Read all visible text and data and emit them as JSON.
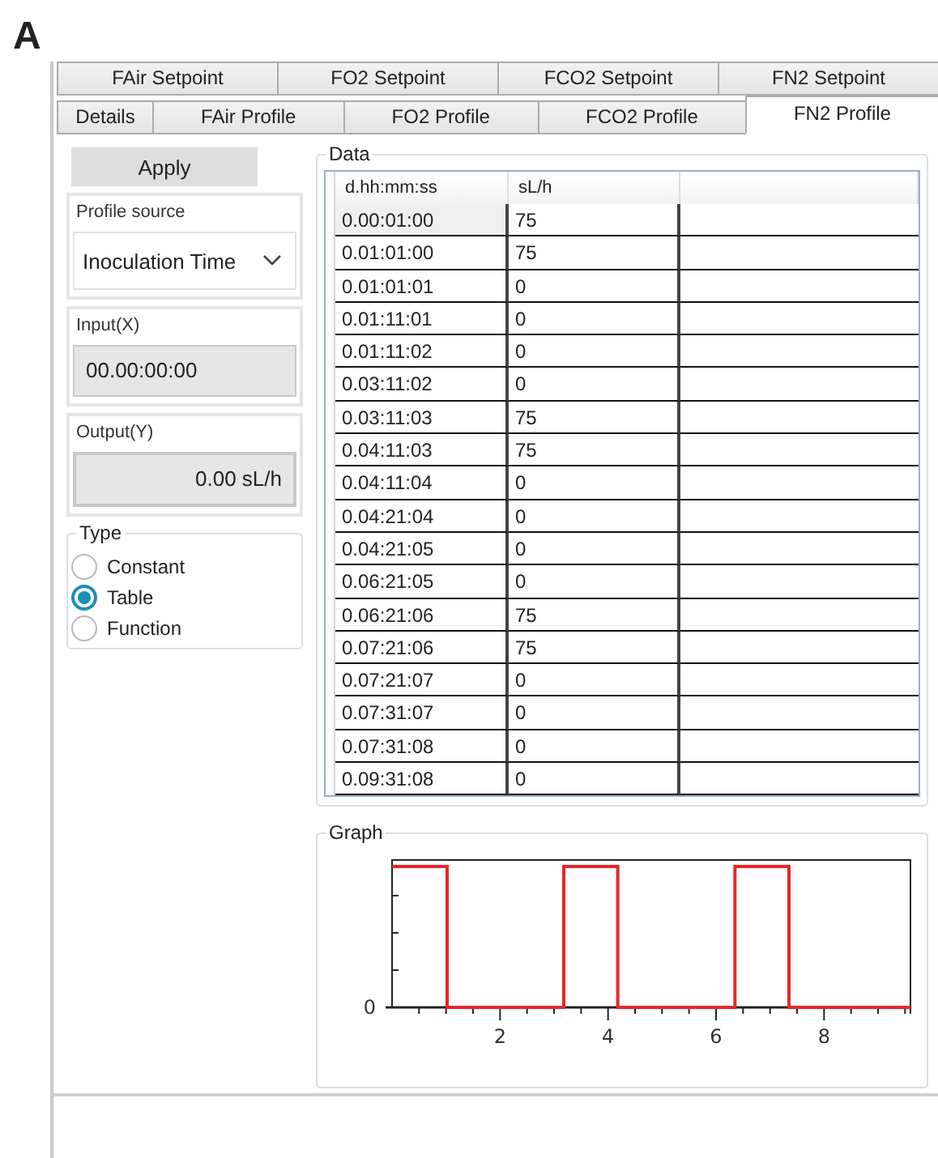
{
  "figure_label": "A",
  "tabs_top": [
    {
      "label": "FAir Setpoint",
      "selected": false
    },
    {
      "label": "FO2 Setpoint",
      "selected": false
    },
    {
      "label": "FCO2 Setpoint",
      "selected": false
    },
    {
      "label": "FN2 Setpoint",
      "selected": false
    }
  ],
  "tabs": [
    {
      "label": "Details",
      "selected": false
    },
    {
      "label": "FAir Profile",
      "selected": false
    },
    {
      "label": "FO2 Profile",
      "selected": false
    },
    {
      "label": "FCO2 Profile",
      "selected": false
    },
    {
      "label": "FN2 Profile",
      "selected": true
    }
  ],
  "apply_button": "Apply",
  "profile_source": {
    "label": "Profile source",
    "value": "Inoculation Time"
  },
  "input": {
    "label": "Input(X)",
    "value": "00.00:00:00"
  },
  "output": {
    "label": "Output(Y)",
    "value": "0.00 sL/h"
  },
  "type": {
    "title": "Type",
    "options": [
      {
        "label": "Constant",
        "selected": false
      },
      {
        "label": "Table",
        "selected": true
      },
      {
        "label": "Function",
        "selected": false
      }
    ]
  },
  "data": {
    "title": "Data",
    "columns": [
      "d.hh:mm:ss",
      "sL/h"
    ],
    "rows": [
      {
        "time": "0.00:01:00",
        "value": "75",
        "selected": true
      },
      {
        "time": "0.01:01:00",
        "value": "75",
        "selected": false
      },
      {
        "time": "0.01:01:01",
        "value": "0",
        "selected": false
      },
      {
        "time": "0.01:11:01",
        "value": "0",
        "selected": false
      },
      {
        "time": "0.01:11:02",
        "value": "0",
        "selected": false
      },
      {
        "time": "0.03:11:02",
        "value": "0",
        "selected": false
      },
      {
        "time": "0.03:11:03",
        "value": "75",
        "selected": false
      },
      {
        "time": "0.04:11:03",
        "value": "75",
        "selected": false
      },
      {
        "time": "0.04:11:04",
        "value": "0",
        "selected": false
      },
      {
        "time": "0.04:21:04",
        "value": "0",
        "selected": false
      },
      {
        "time": "0.04:21:05",
        "value": "0",
        "selected": false
      },
      {
        "time": "0.06:21:05",
        "value": "0",
        "selected": false
      },
      {
        "time": "0.06:21:06",
        "value": "75",
        "selected": false
      },
      {
        "time": "0.07:21:06",
        "value": "75",
        "selected": false
      },
      {
        "time": "0.07:21:07",
        "value": "0",
        "selected": false
      },
      {
        "time": "0.07:31:07",
        "value": "0",
        "selected": false
      },
      {
        "time": "0.07:31:08",
        "value": "0",
        "selected": false
      },
      {
        "time": "0.09:31:08",
        "value": "0",
        "selected": false
      }
    ]
  },
  "graph": {
    "title": "Graph",
    "y_tick_label": "0",
    "x_tick_labels": [
      "2",
      "4",
      "6",
      "8"
    ]
  }
}
